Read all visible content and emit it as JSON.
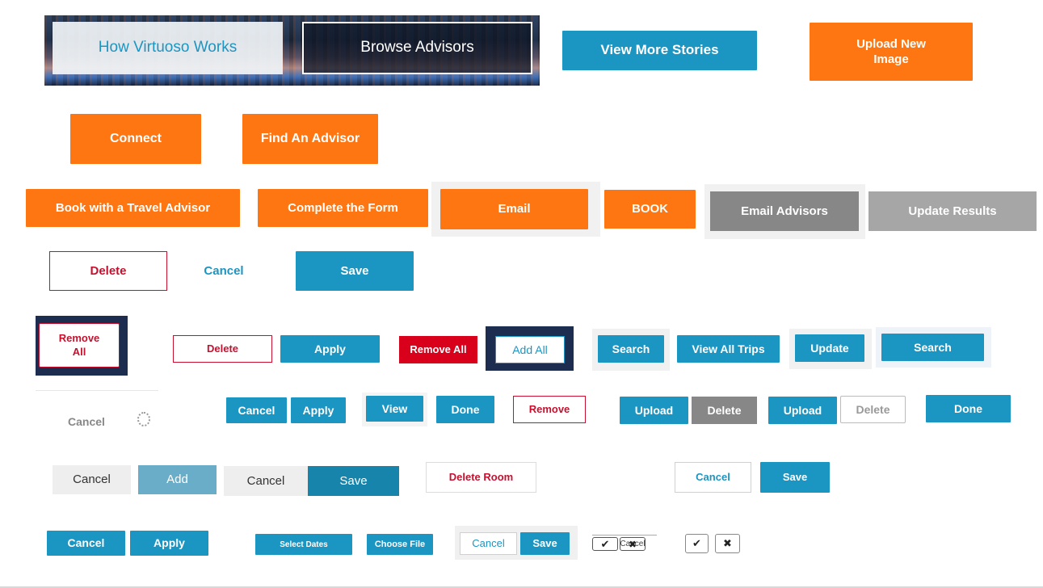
{
  "hero": {
    "how_label": "How Virtuoso Works",
    "browse_label": "Browse Advisors"
  },
  "row1": {
    "view_more_stories": "View More Stories",
    "upload_new_image": "Upload New Image"
  },
  "row2": {
    "connect": "Connect",
    "find_advisor": "Find An Advisor"
  },
  "row3": {
    "book_travel_advisor": "Book with a Travel Advisor",
    "complete_form": "Complete the Form",
    "email": "Email",
    "book": "BOOK",
    "email_advisors": "Email Advisors",
    "update_results": "Update Results"
  },
  "row4": {
    "delete": "Delete",
    "cancel": "Cancel",
    "save": "Save"
  },
  "row5": {
    "remove_all_dark": "Remove All",
    "delete": "Delete",
    "apply": "Apply",
    "remove_all_red": "Remove All",
    "add_all": "Add All",
    "search": "Search",
    "view_all_trips": "View All Trips",
    "update": "Update",
    "search2": "Search"
  },
  "row6": {
    "cancel_gray": "Cancel",
    "cancel": "Cancel",
    "apply": "Apply",
    "view": "View",
    "done": "Done",
    "remove": "Remove",
    "upload": "Upload",
    "delete_gray": "Delete",
    "upload2": "Upload",
    "delete_outline": "Delete",
    "done2": "Done"
  },
  "row7": {
    "cancel": "Cancel",
    "add": "Add",
    "cancel2": "Cancel",
    "save": "Save",
    "delete_room": "Delete Room",
    "cancel3": "Cancel",
    "save2": "Save"
  },
  "row8": {
    "cancel": "Cancel",
    "apply": "Apply",
    "select_dates": "Select Dates",
    "choose_file": "Choose File",
    "cancel2": "Cancel",
    "save": "Save",
    "cancel_overlap": "Cancel"
  },
  "colors": {
    "orange": "#fd7611",
    "blue": "#1b95c2",
    "gray": "#878787",
    "red": "#d9001b",
    "navy": "#1d2d4f"
  }
}
